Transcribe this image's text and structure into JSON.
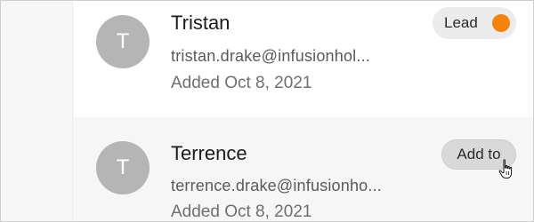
{
  "contacts": [
    {
      "initial": "T",
      "name": "Tristan",
      "email": "tristan.drake@infusionhol...",
      "added": "Added Oct 8, 2021",
      "badge_label": "Lead",
      "badge_dot_color": "#f5820a"
    },
    {
      "initial": "T",
      "name": "Terrence",
      "email": "terrence.drake@infusionho...",
      "added": "Added Oct 8, 2021",
      "action_label": "Add to"
    }
  ],
  "colors": {
    "avatar": "#b5b5b5",
    "hovered_row": "#f6f6f6",
    "lead_dot": "#f5820a"
  },
  "icons": {
    "cursor": "hand-pointer-icon"
  }
}
